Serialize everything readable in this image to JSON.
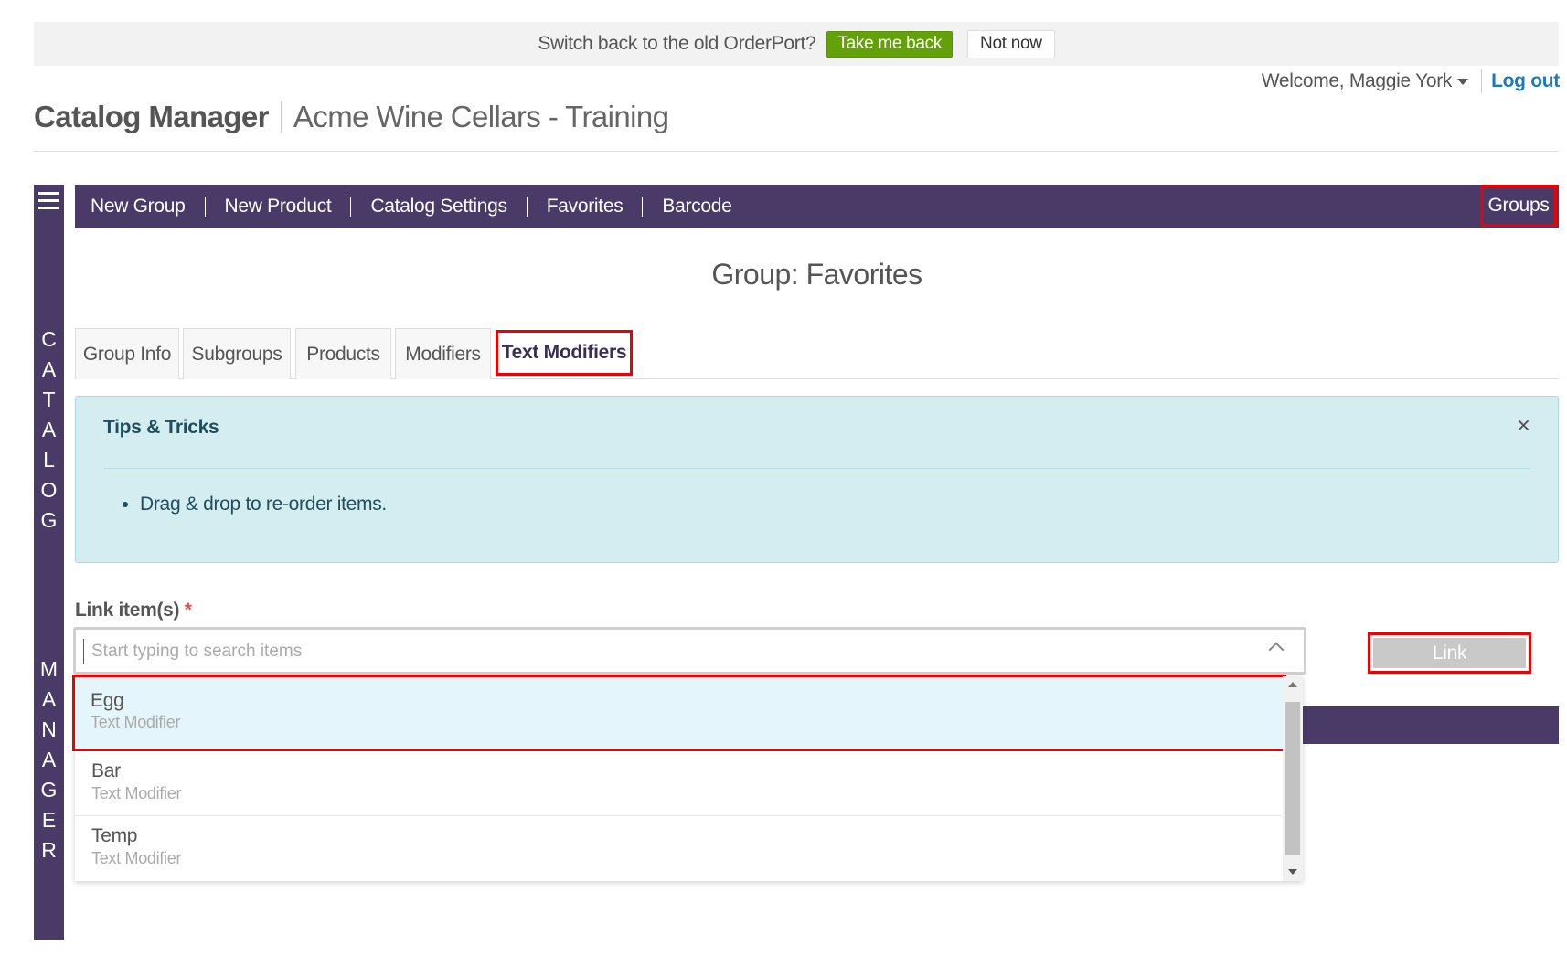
{
  "banner": {
    "text": "Switch back to the old OrderPort?",
    "take_me_back": "Take me back",
    "not_now": "Not now"
  },
  "header": {
    "welcome": "Welcome, Maggie York",
    "logout": "Log out",
    "title": "Catalog Manager",
    "subtitle": "Acme Wine Cellars - Training"
  },
  "sidebar": {
    "word1": [
      "C",
      "A",
      "T",
      "A",
      "L",
      "O",
      "G"
    ],
    "word2": [
      "M",
      "A",
      "N",
      "A",
      "G",
      "E",
      "R"
    ]
  },
  "nav": {
    "items": [
      "New Group",
      "New Product",
      "Catalog Settings",
      "Favorites",
      "Barcode"
    ],
    "groups": "Groups"
  },
  "page": {
    "heading": "Group: Favorites"
  },
  "tabs": [
    {
      "label": "Group Info"
    },
    {
      "label": "Subgroups"
    },
    {
      "label": "Products"
    },
    {
      "label": "Modifiers"
    },
    {
      "label": "Text Modifiers",
      "active": true
    }
  ],
  "tips": {
    "title": "Tips & Tricks",
    "close": "×",
    "items": [
      "Drag & drop to re-order items."
    ]
  },
  "link_form": {
    "label": "Link item(s)",
    "required_marker": "*",
    "placeholder": "Start typing to search items",
    "value": "",
    "button": "Link"
  },
  "dropdown": {
    "options": [
      {
        "name": "Egg",
        "type": "Text Modifier",
        "highlighted": true
      },
      {
        "name": "Bar",
        "type": "Text Modifier"
      },
      {
        "name": "Temp",
        "type": "Text Modifier"
      }
    ]
  },
  "colors": {
    "purple": "#4a3a68",
    "green": "#63a108",
    "highlight_red": "#ee0000",
    "link_blue": "#1a7bbd",
    "tips_bg": "#d4edf1"
  }
}
